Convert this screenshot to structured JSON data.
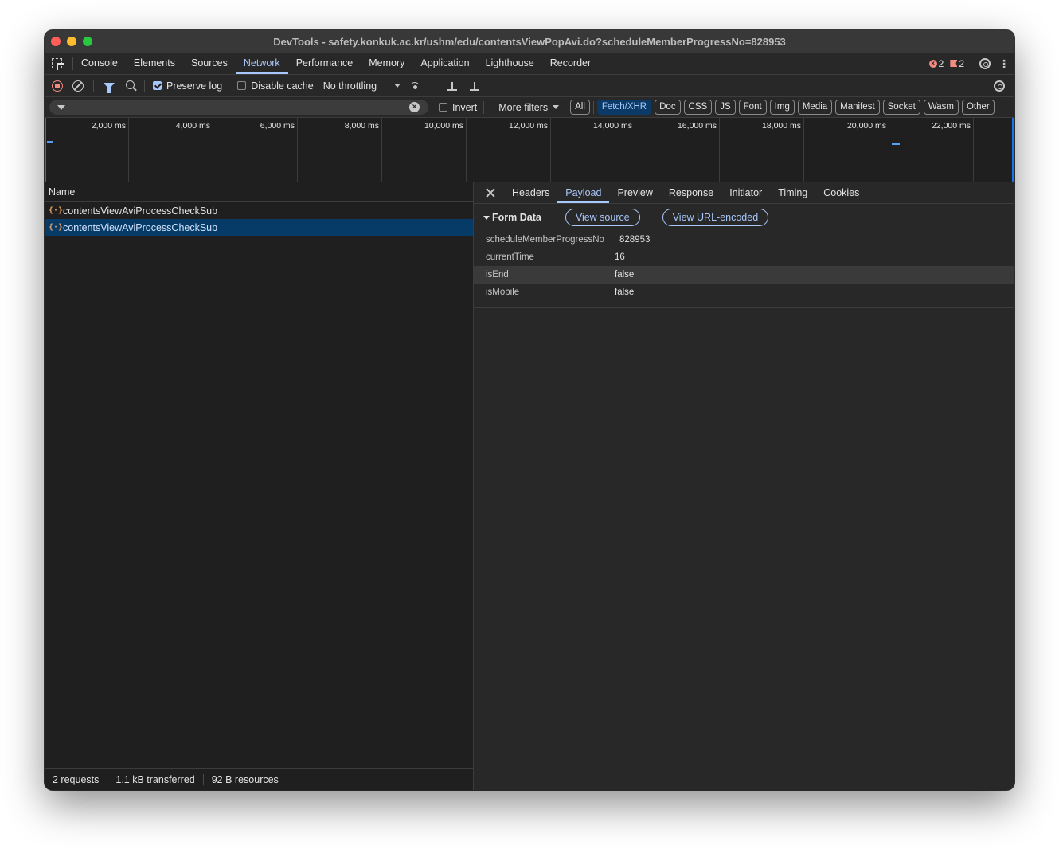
{
  "window": {
    "title": "DevTools - safety.konkuk.ac.kr/ushm/edu/contentsViewPopAvi.do?scheduleMemberProgressNo=828953"
  },
  "tabs": [
    {
      "label": "Console"
    },
    {
      "label": "Elements"
    },
    {
      "label": "Sources"
    },
    {
      "label": "Network",
      "active": true
    },
    {
      "label": "Performance"
    },
    {
      "label": "Memory"
    },
    {
      "label": "Application"
    },
    {
      "label": "Lighthouse"
    },
    {
      "label": "Recorder"
    }
  ],
  "badges": {
    "errors": "2",
    "issues": "2"
  },
  "toolbar": {
    "preserve_log": "Preserve log",
    "disable_cache": "Disable cache",
    "throttling": "No throttling"
  },
  "filter": {
    "placeholder": "",
    "value": "",
    "invert": "Invert",
    "more_filters": "More filters",
    "chips": [
      {
        "label": "All",
        "active": false
      },
      {
        "label": "Fetch/XHR",
        "active": true
      },
      {
        "label": "Doc"
      },
      {
        "label": "CSS"
      },
      {
        "label": "JS"
      },
      {
        "label": "Font"
      },
      {
        "label": "Img"
      },
      {
        "label": "Media"
      },
      {
        "label": "Manifest"
      },
      {
        "label": "Socket"
      },
      {
        "label": "Wasm"
      },
      {
        "label": "Other"
      }
    ]
  },
  "timeline": {
    "ticks": [
      "2,000 ms",
      "4,000 ms",
      "6,000 ms",
      "8,000 ms",
      "10,000 ms",
      "12,000 ms",
      "14,000 ms",
      "16,000 ms",
      "18,000 ms",
      "20,000 ms",
      "22,000 ms"
    ]
  },
  "requests": {
    "header": "Name",
    "rows": [
      {
        "name": "contentsViewAviProcessCheckSub",
        "selected": false
      },
      {
        "name": "contentsViewAviProcessCheckSub",
        "selected": true
      }
    ]
  },
  "status": {
    "requests": "2 requests",
    "transferred": "1.1 kB transferred",
    "resources": "92 B resources"
  },
  "detail": {
    "tabs": [
      {
        "label": "Headers"
      },
      {
        "label": "Payload",
        "active": true
      },
      {
        "label": "Preview"
      },
      {
        "label": "Response"
      },
      {
        "label": "Initiator"
      },
      {
        "label": "Timing"
      },
      {
        "label": "Cookies"
      }
    ],
    "form_data_title": "Form Data",
    "view_source": "View source",
    "view_url_encoded": "View URL-encoded",
    "params": [
      {
        "key": "scheduleMemberProgressNo",
        "value": "828953"
      },
      {
        "key": "currentTime",
        "value": "16"
      },
      {
        "key": "isEnd",
        "value": "false"
      },
      {
        "key": "isMobile",
        "value": "false"
      }
    ]
  },
  "colors": {
    "accent": "#a8c7fa",
    "selected_row": "#053b66",
    "background": "#1f1f1f",
    "error": "#f28b82"
  }
}
